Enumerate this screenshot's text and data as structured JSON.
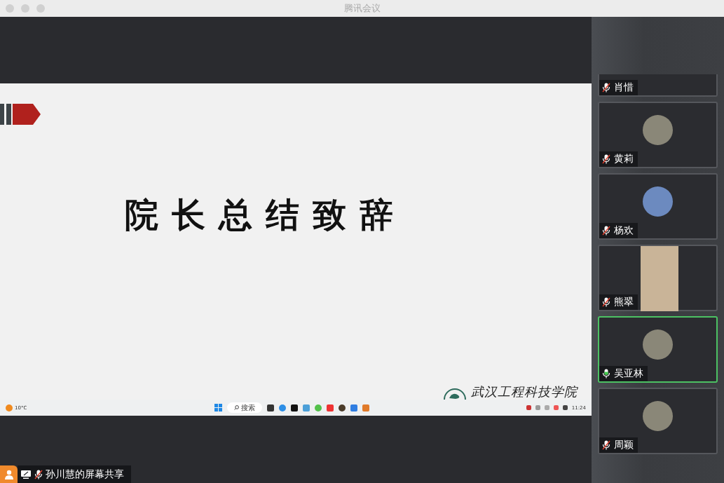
{
  "window": {
    "title": "腾讯会议"
  },
  "shared_screen": {
    "slide_title": "院长总结致辞",
    "logo_text": "武汉工程科技学院",
    "taskbar": {
      "temperature": "10°C",
      "search": "搜索",
      "time": "11:24"
    }
  },
  "participants": [
    {
      "name": "肖惜",
      "muted": true,
      "speaking": false,
      "kind": "none",
      "cut": true
    },
    {
      "name": "黄莉",
      "muted": true,
      "speaking": false,
      "kind": "photo",
      "cut": false
    },
    {
      "name": "杨欢",
      "muted": true,
      "speaking": false,
      "kind": "plain",
      "cut": false
    },
    {
      "name": "熊翠",
      "muted": true,
      "speaking": false,
      "kind": "video",
      "cut": false
    },
    {
      "name": "吴亚林",
      "muted": false,
      "speaking": true,
      "kind": "photo",
      "cut": false
    },
    {
      "name": "周颖",
      "muted": true,
      "speaking": false,
      "kind": "photo",
      "cut": false
    }
  ],
  "share_label": {
    "text": "孙川慧的屏幕共享",
    "muted": true
  }
}
